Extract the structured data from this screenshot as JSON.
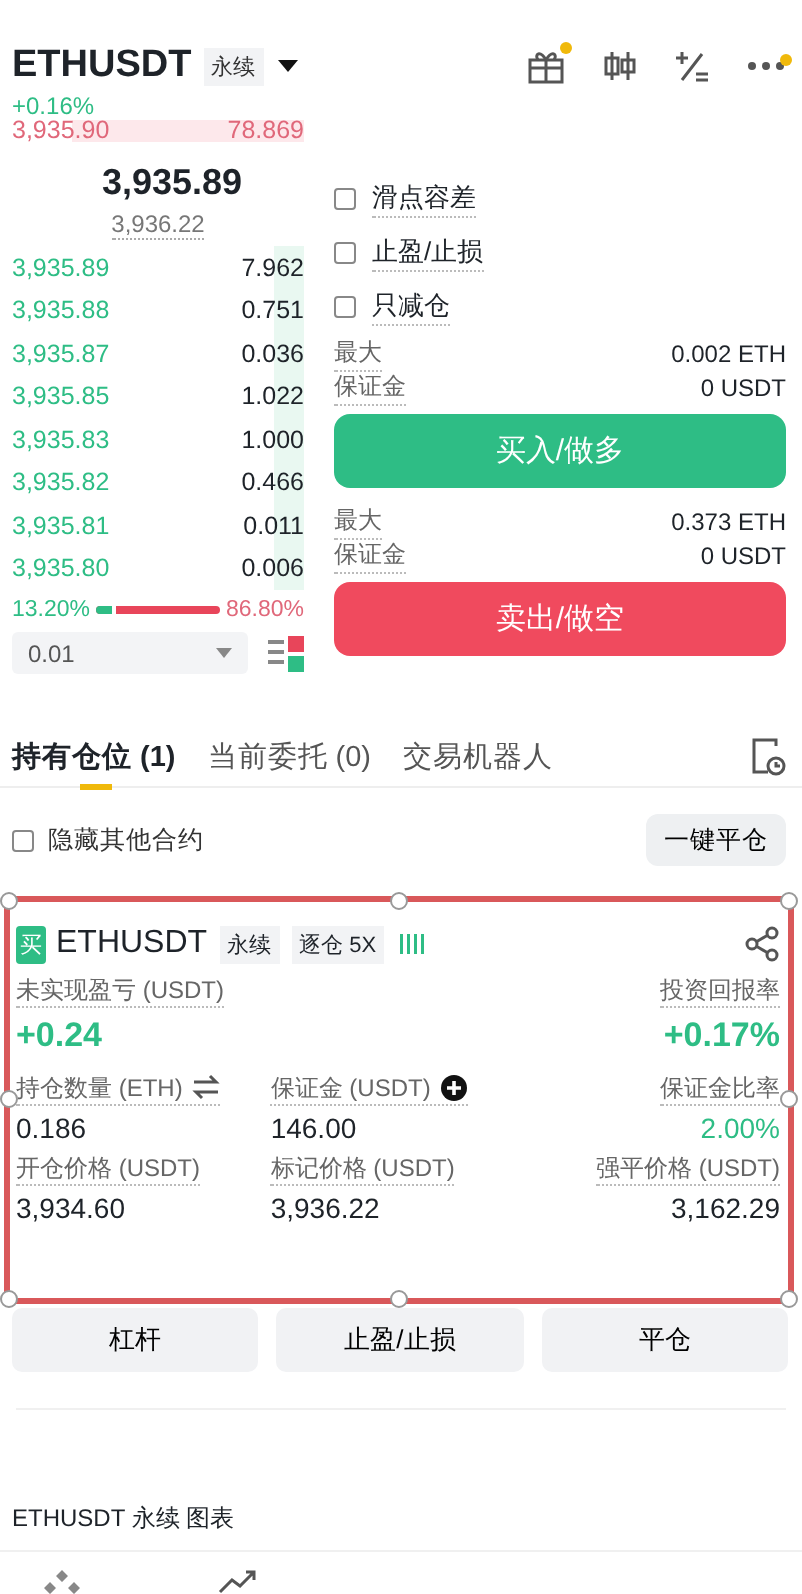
{
  "header": {
    "symbol": "ETHUSDT",
    "tag": "永续",
    "change": "+0.16%"
  },
  "header_icons": [
    {
      "kind": "gift",
      "badge": true
    },
    {
      "kind": "candles",
      "badge": false
    },
    {
      "kind": "calculator",
      "badge": false
    },
    {
      "kind": "more",
      "badge": true
    }
  ],
  "order_book": {
    "asks": [
      {
        "price": "3,935.90",
        "amount": "78.869"
      }
    ],
    "last_price": "3,935.89",
    "mark_price": "3,936.22",
    "bids": [
      {
        "price": "3,935.89",
        "amount": "7.962"
      },
      {
        "price": "3,935.88",
        "amount": "0.751"
      },
      {
        "price": "3,935.87",
        "amount": "0.036"
      },
      {
        "price": "3,935.85",
        "amount": "1.022"
      },
      {
        "price": "3,935.83",
        "amount": "1.000"
      },
      {
        "price": "3,935.82",
        "amount": "0.466"
      },
      {
        "price": "3,935.81",
        "amount": "0.011"
      },
      {
        "price": "3,935.80",
        "amount": "0.006"
      }
    ],
    "buy_ratio": "13.20%",
    "sell_ratio": "86.80%",
    "ratio_bar": {
      "level": 0.132
    },
    "precision": "0.01"
  },
  "options": [
    {
      "label": "滑点容差",
      "checked": false
    },
    {
      "label": "止盈/止损",
      "checked": false
    },
    {
      "label": "只减仓",
      "checked": false
    }
  ],
  "orders": [
    {
      "kind": "buy",
      "max_label": "最大",
      "max": "0.002 ETH",
      "margin_label": "保证金",
      "margin": "0 USDT",
      "button": "买入/做多"
    },
    {
      "kind": "sell",
      "max_label": "最大",
      "max": "0.373 ETH",
      "margin_label": "保证金",
      "margin": "0 USDT",
      "button": "卖出/做空"
    }
  ],
  "tabs": [
    {
      "label": "持有仓位 (1)",
      "selected": true
    },
    {
      "label": "当前委托 (0)",
      "selected": false
    },
    {
      "label": "交易机器人",
      "selected": false
    }
  ],
  "hide_others": {
    "label": "隐藏其他合约",
    "checked": false
  },
  "close_all": "一键平仓",
  "position": {
    "side": "买",
    "symbol": "ETHUSDT",
    "tags": [
      "永续",
      "逐仓 5X"
    ],
    "pnl": {
      "label": "未实现盈亏 (USDT)",
      "value": "+0.24"
    },
    "roe": {
      "label": "投资回报率",
      "value": "+0.17%"
    },
    "details": [
      {
        "label": "持仓数量 (ETH)",
        "value": "0.186",
        "kind": "plain"
      },
      {
        "label": "保证金 (USDT)",
        "value": "146.00",
        "kind": "plain"
      },
      {
        "label": "保证金比率",
        "value": "2.00%",
        "kind": "positive"
      },
      {
        "label": "开仓价格 (USDT)",
        "value": "3,934.60",
        "kind": "plain"
      },
      {
        "label": "标记价格 (USDT)",
        "value": "3,936.22",
        "kind": "plain"
      },
      {
        "label": "强平价格 (USDT)",
        "value": "3,162.29",
        "kind": "plain"
      }
    ]
  },
  "actions": [
    "杠杆",
    "止盈/止损",
    "平仓"
  ],
  "bottom_label": "ETHUSDT 永续  图表",
  "nav_icons": [
    {
      "kind": "diamond"
    },
    {
      "kind": "chart"
    }
  ]
}
